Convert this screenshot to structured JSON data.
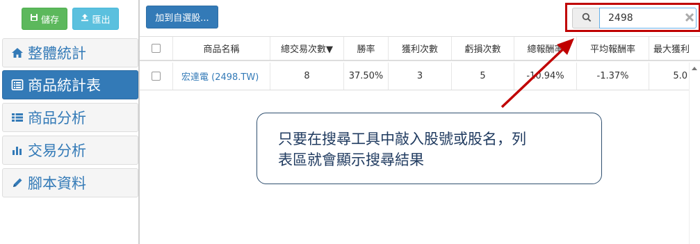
{
  "sidebar": {
    "save_label": "儲存",
    "export_label": "匯出",
    "items": [
      {
        "label": "整體統計",
        "icon": "home-icon",
        "active": false
      },
      {
        "label": "商品統計表",
        "icon": "list-icon",
        "active": true
      },
      {
        "label": "商品分析",
        "icon": "bulleted-list-icon",
        "active": false
      },
      {
        "label": "交易分析",
        "icon": "bar-chart-icon",
        "active": false
      },
      {
        "label": "腳本資料",
        "icon": "pencil-icon",
        "active": false
      }
    ]
  },
  "toolbar": {
    "add_favorite_label": "加到自選股...",
    "search": {
      "value": "2498",
      "placeholder": ""
    }
  },
  "table": {
    "headers": [
      "商品名稱",
      "總交易次數▼",
      "勝率",
      "獲利次數",
      "虧損次數",
      "總報酬率",
      "平均報酬率",
      "最大獲利"
    ],
    "rows": [
      {
        "name": "宏達電 (2498.TW)",
        "trades": "8",
        "win_rate": "37.50%",
        "wins": "3",
        "losses": "5",
        "total_return": "-10.94%",
        "avg_return": "-1.37%",
        "max_profit": "5.0"
      }
    ]
  },
  "callout": {
    "line1": "只要在搜尋工具中敲入股號或股名，列",
    "line2": "表區就會顯示搜尋結果"
  },
  "colors": {
    "primary": "#337ab7",
    "success": "#5cb85c",
    "info": "#5bc0de",
    "highlight": "#c00000"
  }
}
